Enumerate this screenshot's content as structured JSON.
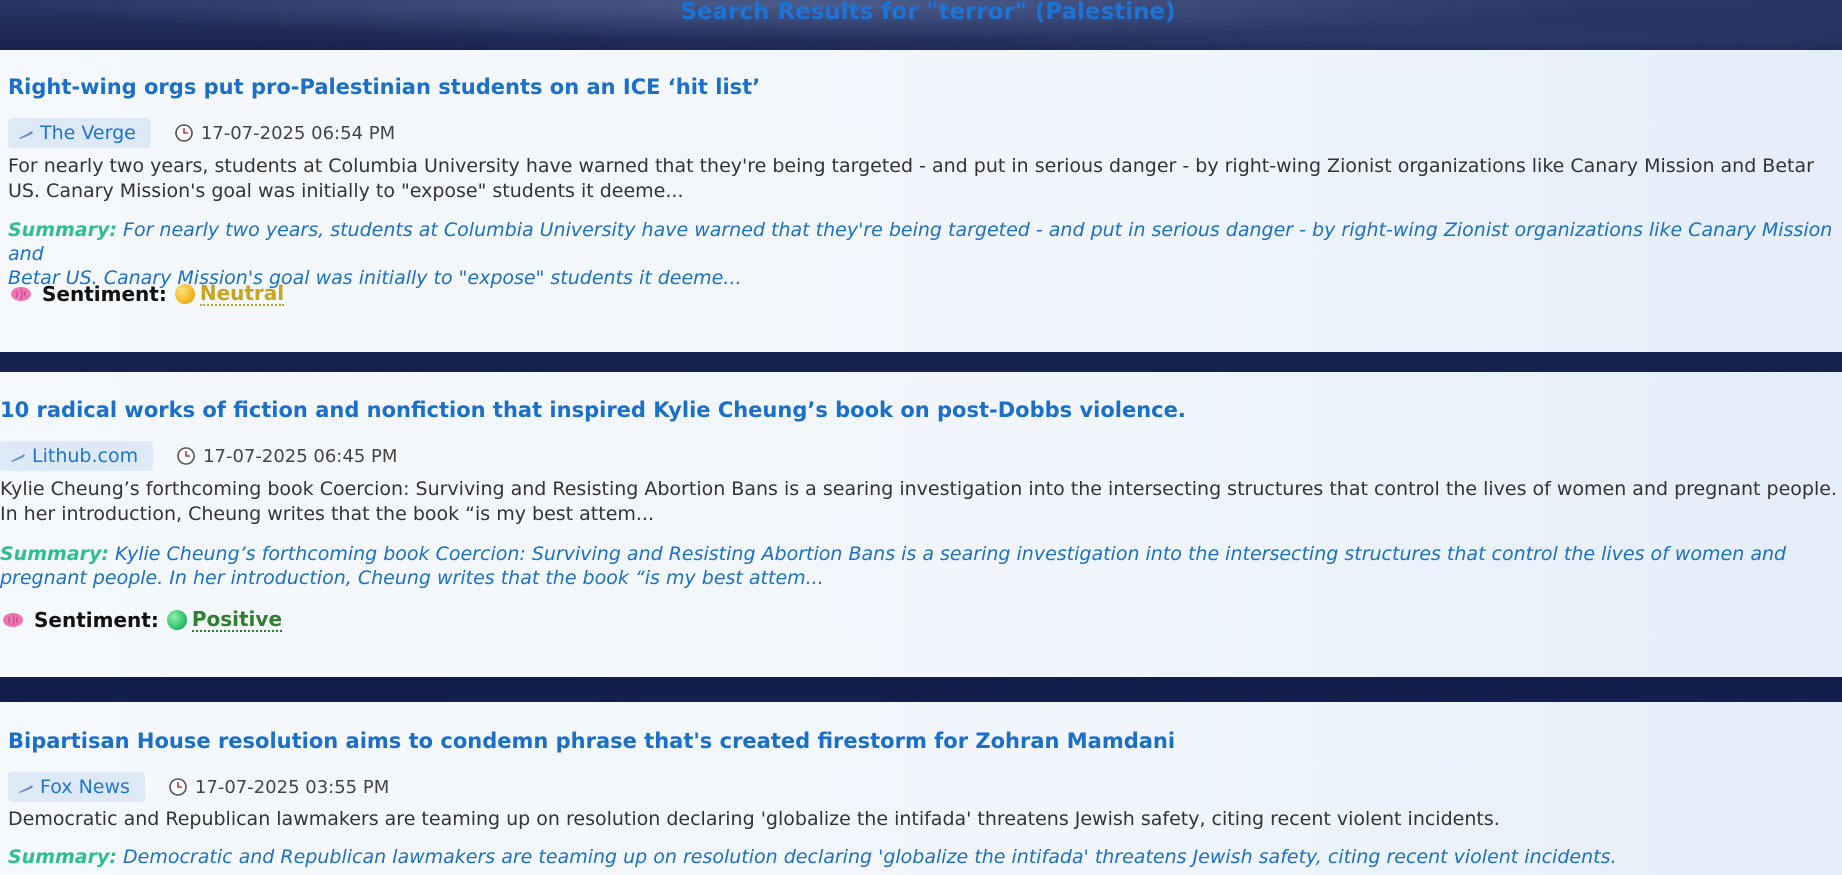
{
  "page": {
    "title": "Search Results for \"terror\" (Palestine)"
  },
  "labels": {
    "summary": "Summary:",
    "sentiment": "Sentiment:"
  },
  "colors": {
    "title_blue": "#1d74d6",
    "summary_label": "#2fbf8f",
    "neutral": "#c8a51c",
    "positive": "#2f7f2f"
  },
  "articles": [
    {
      "title": "Right-wing orgs put pro-Palestinian students on an ICE ‘hit list’",
      "source": "The Verge",
      "source_icon": "pen-icon",
      "date": "17-07-2025 06:54 PM",
      "description_line1": "For nearly two years, students at Columbia University have warned that they're being targeted - and put in serious danger - by right-wing Zionist organizations like Canary Mission and Betar",
      "description_line2": "US. Canary Mission's goal was initially to \"expose\" students it deeme...",
      "summary_line1": "For nearly two years, students at Columbia University have warned that they're being targeted - and put in serious danger - by right-wing Zionist organizations like Canary Mission and",
      "summary_line2": "Betar US. Canary Mission's goal was initially to \"expose\" students it deeme...",
      "sentiment": "Neutral",
      "sentiment_icon": "yellow-dot-icon"
    },
    {
      "title": "10 radical works of fiction and nonfiction that inspired Kylie Cheung’s book on post-Dobbs violence.",
      "source": "Lithub.com",
      "source_icon": "pen-icon",
      "date": "17-07-2025 06:45 PM",
      "description_line1": "Kylie Cheung’s forthcoming book Coercion: Surviving and Resisting Abortion Bans is a searing investigation into the intersecting structures that control the lives of women and pregnant people.",
      "description_line2": "In her introduction, Cheung writes that the book “is my best attem...",
      "summary_line1": "Kylie Cheung’s forthcoming book Coercion: Surviving and Resisting Abortion Bans is a searing investigation into the intersecting structures that control the lives of women and",
      "summary_line2": "pregnant people. In her introduction, Cheung writes that the book “is my best attem...",
      "sentiment": "Positive",
      "sentiment_icon": "green-dot-icon"
    },
    {
      "title": "Bipartisan House resolution aims to condemn phrase that's created firestorm for Zohran Mamdani",
      "source": "Fox News",
      "source_icon": "pen-icon",
      "date": "17-07-2025 03:55 PM",
      "description_line1": "Democratic and Republican lawmakers are teaming up on resolution declaring 'globalize the intifada' threatens Jewish safety, citing recent violent incidents.",
      "summary_line1": "Democratic and Republican lawmakers are teaming up on resolution declaring 'globalize the intifada' threatens Jewish safety, citing recent violent incidents."
    }
  ]
}
